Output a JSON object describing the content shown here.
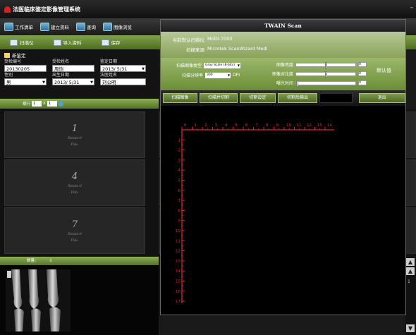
{
  "app": {
    "title": "法医临床鉴定影像管理系统",
    "minimize": "–"
  },
  "toolbar": [
    {
      "name": "worklist",
      "label": "工作清单"
    },
    {
      "name": "create",
      "label": "建立资料"
    },
    {
      "name": "search",
      "label": "查询"
    },
    {
      "name": "image-view",
      "label": "图像浏览"
    }
  ],
  "subtoolbar": {
    "scan": "扫描仪",
    "import": "导入资料",
    "save": "保存"
  },
  "form": {
    "heading": "新鉴定",
    "fields": [
      {
        "label": "受检编号",
        "value": "20130205"
      },
      {
        "label": "受检姓名",
        "value": "周恺"
      },
      {
        "label": "鉴定日期",
        "value": "2013/ 5/31"
      },
      {
        "label": "性别",
        "value": "男"
      },
      {
        "label": "出生日期",
        "value": "2013/ 5/31"
      },
      {
        "label": "法医姓名",
        "value": "刘公明"
      }
    ]
  },
  "pagebar": {
    "prefix": "横行",
    "cols": "1",
    "x": "X",
    "rows": "1"
  },
  "tiles": [
    {
      "num": "1",
      "rot1": "Rotate:0",
      "rot2": "Flip:"
    },
    {
      "num": "4",
      "rot1": "Rotate:0",
      "rot2": "Flip:"
    },
    {
      "num": "7",
      "rot1": "Rotate:0",
      "rot2": "Flip:"
    }
  ],
  "thumbbar": {
    "label": "数量：",
    "count": "1"
  },
  "dialog": {
    "title": "TWAIN Scan",
    "default_scanner_label": "当前默认扫描仪",
    "default_scanner": "MEDI-7000",
    "source_label": "扫描来源",
    "source": "Microtek ScanWizard Medi",
    "image_type_label": "扫描图像类型",
    "image_type": "Gray Scale (8-bits)",
    "resolution_label": "扫描分辨率",
    "resolution": "300",
    "dpi": "DPI",
    "brightness_label": "图像亮度",
    "contrast_label": "图像对比度",
    "exposure_label": "曝光时间",
    "brightness_value": "0",
    "contrast_value": "0",
    "exposure_value": "0",
    "brightness_level": 0.5,
    "contrast_level": 0.5,
    "exposure_level": 0.0,
    "default_label": "默认值",
    "buttons": [
      "扫描图像",
      "扫描并切割",
      "切割设定",
      "切割后输出",
      "",
      "退出"
    ]
  },
  "ruler": {
    "color": "#e0282a",
    "top_ticks": [
      "0",
      "1",
      "2",
      "3",
      "4",
      "5",
      "6",
      "7",
      "8",
      "9",
      "10",
      "11",
      "12",
      "13",
      "14"
    ],
    "left_ticks": [
      "1",
      "2",
      "3",
      "4",
      "5",
      "6",
      "7",
      "8",
      "9",
      "10",
      "11",
      "12",
      "13",
      "14",
      "15",
      "16",
      "17"
    ]
  },
  "side": {
    "up": "▲",
    "page": "1",
    "down": "▼"
  }
}
